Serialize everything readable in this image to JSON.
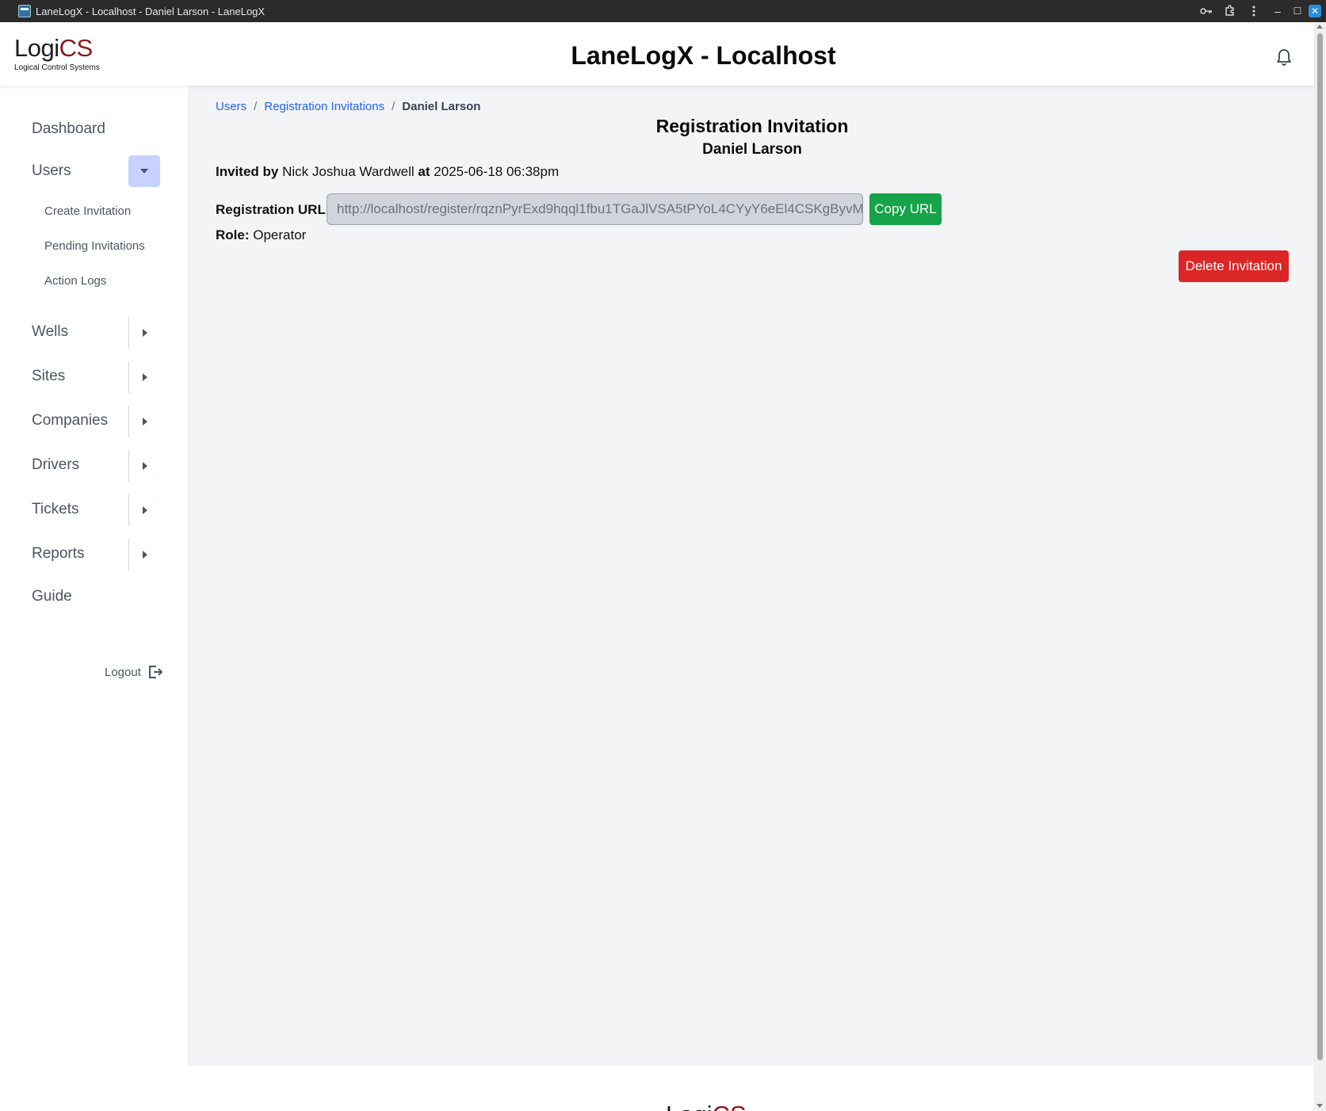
{
  "window": {
    "title": "LaneLogX - Localhost - Daniel Larson - LaneLogX",
    "controls": {
      "minimize": "–",
      "maximize": "☐",
      "close": "✕"
    }
  },
  "logo": {
    "part1": "Logi",
    "part2": "CS",
    "tagline": "Logical Control Systems"
  },
  "header": {
    "title": "LaneLogX - Localhost"
  },
  "sidebar": {
    "items": [
      {
        "label": "Dashboard"
      },
      {
        "label": "Users",
        "expanded": true,
        "children": [
          "Create Invitation",
          "Pending Invitations",
          "Action Logs"
        ]
      },
      {
        "label": "Wells"
      },
      {
        "label": "Sites"
      },
      {
        "label": "Companies"
      },
      {
        "label": "Drivers"
      },
      {
        "label": "Tickets"
      },
      {
        "label": "Reports"
      },
      {
        "label": "Guide"
      }
    ],
    "logout_label": "Logout"
  },
  "breadcrumb": {
    "items": [
      "Users",
      "Registration Invitations"
    ],
    "current": "Daniel Larson",
    "separator": "/"
  },
  "page": {
    "title": "Registration Invitation",
    "subtitle": "Daniel Larson",
    "invited_by_label": "Invited by",
    "invited_by": "Nick Joshua Wardwell",
    "at_label": "at",
    "invited_at": "2025-06-18 06:38pm",
    "url_label": "Registration URL:",
    "url_value": "http://localhost/register/rqznPyrExd9hqql1fbu1TGaJlVSA5tPYoL4CYyY6eEl4CSKgByvM",
    "copy_label": "Copy URL",
    "role_label": "Role:",
    "role": "Operator",
    "delete_label": "Delete Invitation"
  },
  "colors": {
    "brand_red": "#8b1a1a",
    "link": "#2563eb",
    "success": "#16a34a",
    "danger": "#dc2626",
    "active_toggle": "#c7d2fe"
  }
}
